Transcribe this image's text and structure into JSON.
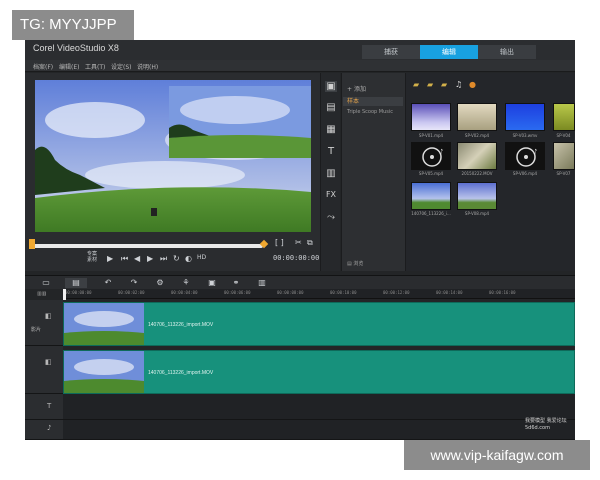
{
  "watermarks": {
    "top": "TG: MYYJJPP",
    "bottom": "www.vip-kaifagw.com"
  },
  "app": {
    "title": "Corel VideoStudio X8"
  },
  "steps": [
    {
      "label": "捕获",
      "active": false
    },
    {
      "label": "编辑",
      "active": true
    },
    {
      "label": "输出",
      "active": false
    }
  ],
  "menu": [
    "档案(F)",
    "编辑(E)",
    "工具(T)",
    "设定(S)",
    "说明(H)"
  ],
  "player": {
    "mode_label_1": "专案",
    "mode_label_2": "素材",
    "timecode": "00:00:00:00",
    "progress": 0.0
  },
  "library": {
    "add_label": "添加",
    "folder_selected": "样本",
    "folder_other": "Triple Scoop Music",
    "browse_label": "浏览",
    "thumbs": [
      {
        "label": "SP-V01.mp4"
      },
      {
        "label": "SP-V02.mp4"
      },
      {
        "label": "SP-V03.wmv"
      },
      {
        "label": "SP-V04"
      },
      {
        "label": "SP-V05.mp4"
      },
      {
        "label": "20150222.MOV"
      },
      {
        "label": "SP-V06.mp4"
      },
      {
        "label": "SP-V07"
      },
      {
        "label": "140706_113226_i..."
      },
      {
        "label": "SP-V08.mp4"
      }
    ]
  },
  "timeline": {
    "ruler": [
      "00:00:00:00",
      "00:00:02:00",
      "00:00:04:00",
      "00:00:06:00",
      "00:00:08:00",
      "00:00:10:00",
      "00:00:12:00",
      "00:00:14:00",
      "00:00:16:00"
    ],
    "clips": [
      {
        "name": "140706_113226_import.MOV"
      },
      {
        "name": "140706_113226_import.MOV"
      }
    ],
    "track_head_1": "影片",
    "corner_1": "我要模型 我爱论坛",
    "corner_2": "5d6d.com"
  },
  "colors": {
    "accent": "#18a1e0",
    "clip": "#17917c",
    "panel": "#2a2c2f",
    "knob": "#f0a830"
  }
}
